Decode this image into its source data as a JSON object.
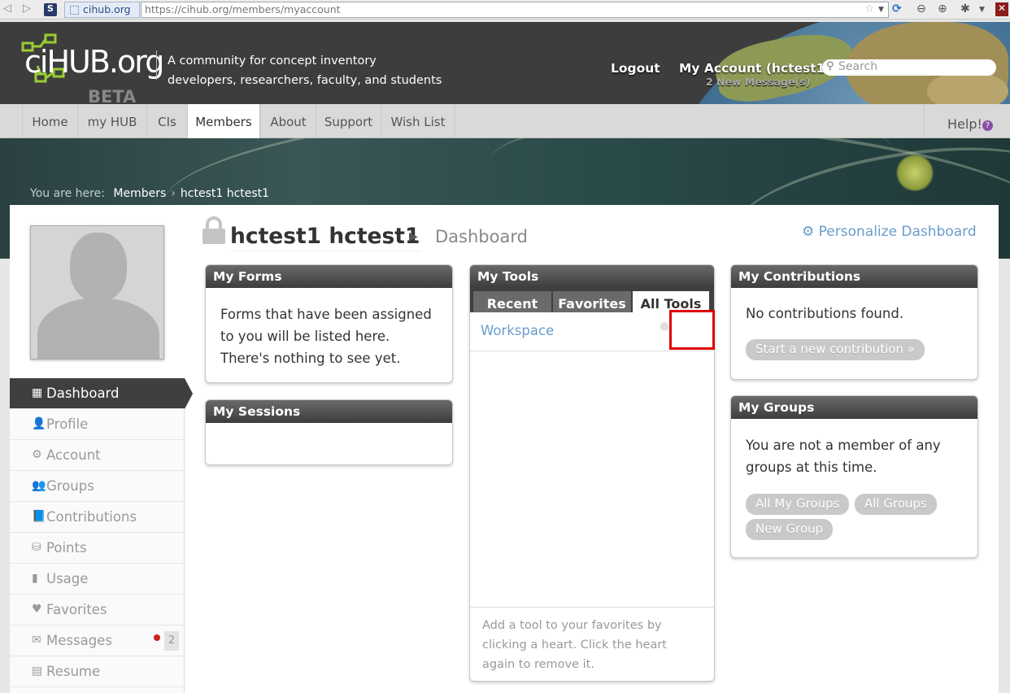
{
  "browser": {
    "site_identity": "cihub.org",
    "url_host": "https://cihub.org",
    "url_path": "/members/myaccount",
    "icons": [
      "back-arrow-icon",
      "forward-arrow-icon",
      "s-addon-icon",
      "star-icon",
      "reload-icon",
      "zoom-out-icon",
      "zoom-in-icon",
      "addon-icon",
      "menu-arrow-icon",
      "close-icon"
    ]
  },
  "header": {
    "logo": "ciHUB.org",
    "beta": "BETA",
    "tagline_line1": "A community for concept inventory",
    "tagline_line2": "developers, researchers, faculty, and students",
    "logout": "Logout",
    "my_account": "My Account (hctest1)",
    "new_messages": "2 New Message(s)",
    "search_placeholder": "Search"
  },
  "nav": {
    "tabs": [
      {
        "label": "Home"
      },
      {
        "label": "my HUB"
      },
      {
        "label": "CIs"
      },
      {
        "label": "Members"
      },
      {
        "label": "About"
      },
      {
        "label": "Support"
      },
      {
        "label": "Wish List"
      }
    ],
    "active_tab": "Members",
    "help": "Help!"
  },
  "breadcrumb": {
    "prefix": "You are here:",
    "items": [
      "Members",
      "hctest1 hctest1"
    ]
  },
  "sidebar": {
    "items": [
      {
        "label": "Dashboard",
        "icon": "dashboard-icon"
      },
      {
        "label": "Profile",
        "icon": "user-icon"
      },
      {
        "label": "Account",
        "icon": "gears-icon"
      },
      {
        "label": "Groups",
        "icon": "groups-icon"
      },
      {
        "label": "Contributions",
        "icon": "book-icon"
      },
      {
        "label": "Points",
        "icon": "coins-icon"
      },
      {
        "label": "Usage",
        "icon": "bar-chart-icon"
      },
      {
        "label": "Favorites",
        "icon": "heart-icon"
      },
      {
        "label": "Messages",
        "icon": "envelope-icon"
      },
      {
        "label": "Resume",
        "icon": "document-icon"
      }
    ],
    "messages_count": "2"
  },
  "main": {
    "user_name": "hctest1 hctest1",
    "section": "Dashboard",
    "personalize": "Personalize Dashboard"
  },
  "forms_card": {
    "title": "My Forms",
    "text": "Forms that have been assigned to you will be listed here. There's nothing to see yet."
  },
  "sessions_card": {
    "title": "My Sessions"
  },
  "tools_card": {
    "title": "My Tools",
    "tabs": [
      "Recent",
      "Favorites",
      "All Tools"
    ],
    "selected_tab": "All Tools",
    "tool_item": "Workspace",
    "footer": "Add a tool to your favorites by clicking a heart. Click the heart again to remove it."
  },
  "contributions_card": {
    "title": "My Contributions",
    "text": "No contributions found.",
    "button": "Start a new contribution »"
  },
  "groups_card": {
    "title": "My Groups",
    "text": "You are not a member of any groups at this time.",
    "buttons": [
      "All My Groups",
      "All Groups",
      "New Group"
    ]
  },
  "colors": {
    "header_bg": "#3d3d3d",
    "link": "#6a9cc9",
    "card_head": "#3d3d3d",
    "highlight": "#e00000"
  }
}
